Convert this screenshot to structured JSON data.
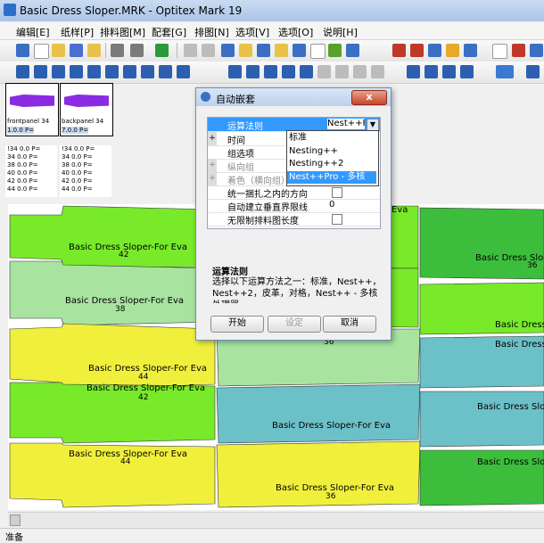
{
  "window": {
    "title": "Basic Dress Sloper.MRK - Optitex Mark 19"
  },
  "menu": [
    "编辑[E]",
    "纸样[P]",
    "排料图[M]",
    "配套[G]",
    "排图[N]",
    "选项[V]",
    "选项[O]",
    "说明[H]"
  ],
  "thumbnails": [
    {
      "name": "frontpanel 34",
      "value": "1.0.0",
      "flag": "P=",
      "stats": [
        "!34 0.0 P=",
        "34 0.0 P=",
        "38 0.0 P=",
        "40 0.0 P=",
        "42 0.0 P=",
        "44 0.0 P="
      ]
    },
    {
      "name": "backpanel 34",
      "value": "7.0.0",
      "flag": "P=",
      "stats": [
        "!34 0.0 P=",
        "34 0.0 P=",
        "38 0.0 P=",
        "40 0.0 P=",
        "42 0.0 P=",
        "44 0.0 P="
      ]
    }
  ],
  "pieces": [
    {
      "label": "Basic Dress Sloper-For Eva",
      "size": "42"
    },
    {
      "label": "Basic Dress Sloper-For Eva",
      "size": "38"
    },
    {
      "label": "Basic Dress Sloper-For Eva",
      "size": "44"
    },
    {
      "label": "Basic Dress Sloper-For Eva",
      "size": "42"
    },
    {
      "label": "Basic Dress Sloper-For Eva",
      "size": "44"
    },
    {
      "label": "Basic Dress Sloper-For Eva",
      "size": "36"
    },
    {
      "label": "Basic Dress Sloper-For Eva",
      "size": "44"
    },
    {
      "label": "Basic Dress Sloper-For Eva",
      "size": "36"
    },
    {
      "label": "Eva",
      "size": ""
    },
    {
      "label": "Basic Dress Slo",
      "size": "36"
    },
    {
      "label": "Basic Dress",
      "size": ""
    },
    {
      "label": "Basic Dress",
      "size": ""
    },
    {
      "label": "Basic Dress Slop",
      "size": ""
    },
    {
      "label": "Basic Dress Slop",
      "size": ""
    }
  ],
  "dialog": {
    "title": "自动嵌套",
    "close": "x",
    "props": [
      {
        "name": "运算法则",
        "value": "Nest++Pr",
        "expand": false,
        "highlight": true
      },
      {
        "name": "时间",
        "value": "",
        "expand": true
      },
      {
        "name": "组选项",
        "value": "",
        "expand": false
      },
      {
        "name": "纵向组",
        "value": "",
        "expand": true,
        "disabled": true
      },
      {
        "name": "着色（横向组）",
        "value": "",
        "expand": true,
        "disabled": true
      },
      {
        "name": "统一捆扎之内的方向",
        "value": "",
        "check": true
      },
      {
        "name": "自动建立垂直界限线",
        "value": "0"
      },
      {
        "name": "无限制排料图长度",
        "value": "",
        "check": true
      }
    ],
    "dropdown_options": [
      "标准",
      "Nesting++",
      "Nesting++2",
      "Nest++Pro - 多核"
    ],
    "selected_option": "Nest++Pro - 多核",
    "description_title": "运算法则",
    "description_text": "选择以下运算方法之一：标准，Nest++，Nest++2，皮革，对格，Nest++ - 多核处理器",
    "buttons": {
      "start": "开始",
      "settings": "设定",
      "cancel": "取消"
    }
  },
  "status": {
    "text": "准备"
  },
  "colors": {
    "yellow": "#f0f03c",
    "green": "#78ea2a",
    "lightgreen": "#a8e4a0",
    "teal": "#6cc0c8",
    "darkgreen": "#3cbe3c",
    "purple": "#8a2be2"
  }
}
